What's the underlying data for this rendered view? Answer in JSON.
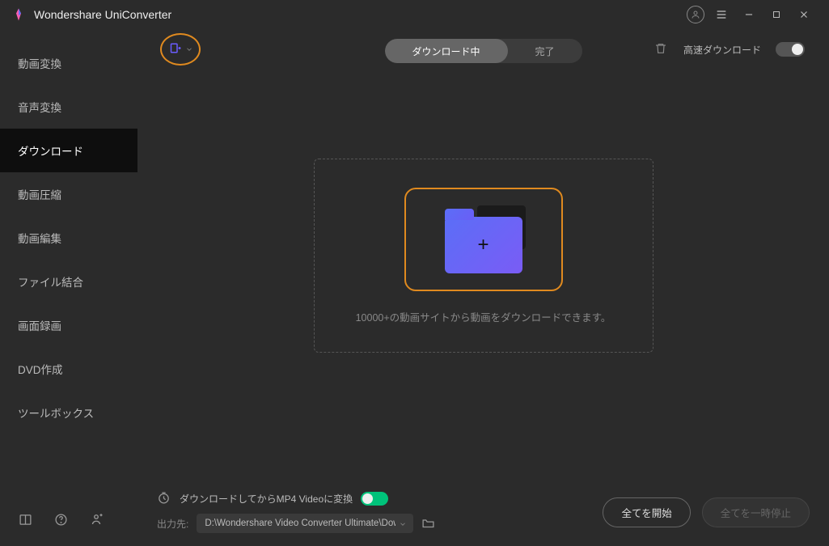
{
  "app": {
    "title": "Wondershare UniConverter"
  },
  "sidebar": {
    "items": [
      {
        "label": "動画変換"
      },
      {
        "label": "音声変換"
      },
      {
        "label": "ダウンロード"
      },
      {
        "label": "動画圧縮"
      },
      {
        "label": "動画編集"
      },
      {
        "label": "ファイル結合"
      },
      {
        "label": "画面録画"
      },
      {
        "label": "DVD作成"
      },
      {
        "label": "ツールボックス"
      }
    ],
    "active_index": 2
  },
  "topbar": {
    "tab_downloading": "ダウンロード中",
    "tab_done": "完了",
    "speed_label": "高速ダウンロード"
  },
  "main": {
    "drop_hint": "10000+の動画サイトから動画をダウンロードできます。"
  },
  "bottom": {
    "convert_label": "ダウンロードしてからMP4 Videoに変換",
    "output_label": "出力先:",
    "output_path": "D:\\Wondershare Video Converter Ultimate\\Dow",
    "start_all": "全てを開始",
    "pause_all": "全てを一時停止"
  }
}
